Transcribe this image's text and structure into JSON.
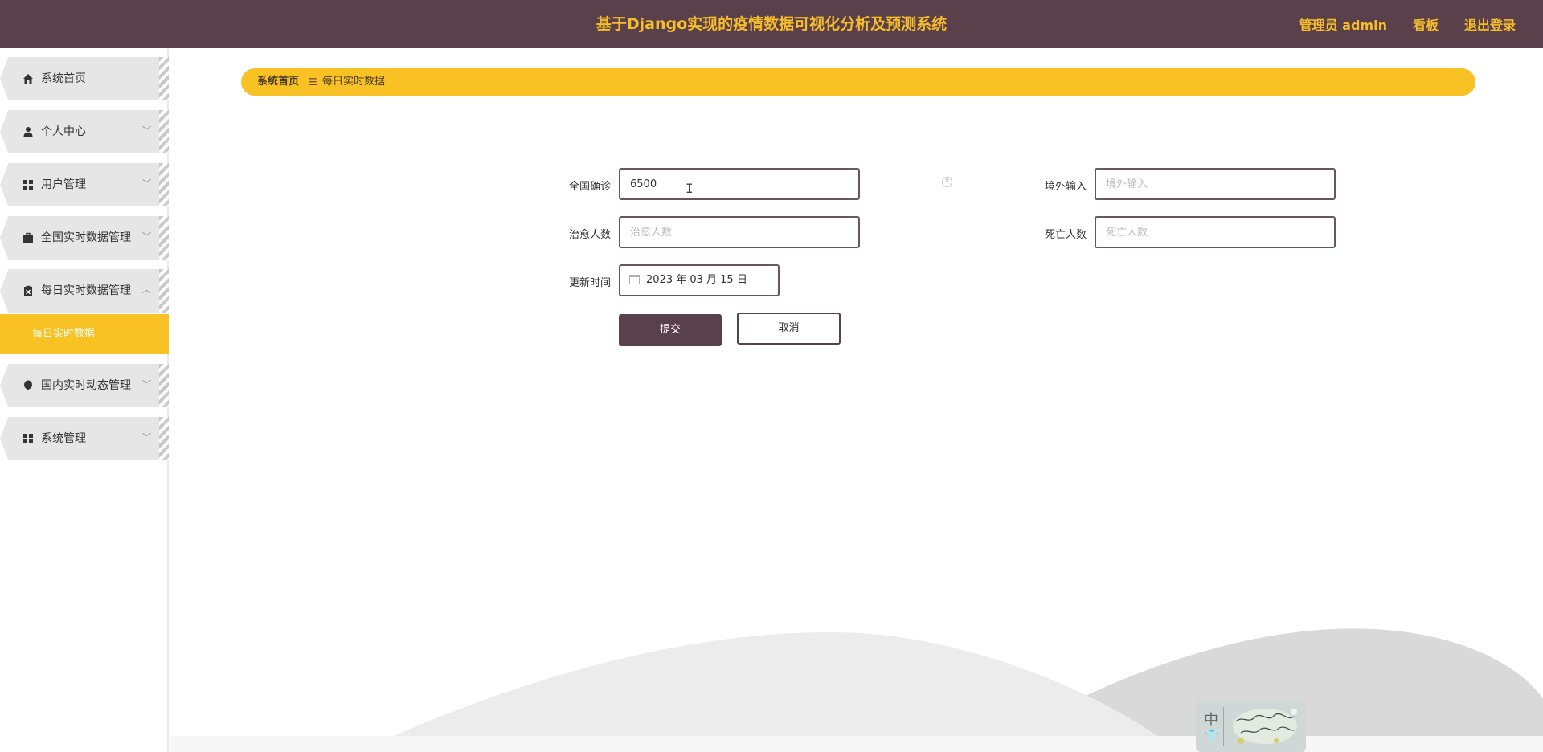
{
  "header": {
    "title": "基于Django实现的疫情数据可视化分析及预测系统",
    "admin_label": "管理员 admin",
    "board_label": "看板",
    "logout_label": "退出登录"
  },
  "sidebar": {
    "items": [
      {
        "label": "系统首页",
        "icon": "home-icon"
      },
      {
        "label": "个人中心",
        "icon": "user-icon"
      },
      {
        "label": "用户管理",
        "icon": "grid-icon"
      },
      {
        "label": "全国实时数据管理",
        "icon": "briefcase-icon"
      },
      {
        "label": "每日实时数据管理",
        "icon": "clipboard-icon",
        "expanded": true
      },
      {
        "label": "国内实时动态管理",
        "icon": "balloon-icon"
      },
      {
        "label": "系统管理",
        "icon": "grid-icon"
      }
    ],
    "sub_active": "每日实时数据"
  },
  "breadcrumb": {
    "home": "系统首页",
    "separator": "☰",
    "current": "每日实时数据"
  },
  "form": {
    "national_confirmed": {
      "label": "全国确诊",
      "value": "6500"
    },
    "imported": {
      "label": "境外输入",
      "placeholder": "境外输入"
    },
    "cured": {
      "label": "治愈人数",
      "placeholder": "治愈人数"
    },
    "deaths": {
      "label": "死亡人数",
      "placeholder": "死亡人数"
    },
    "update_time": {
      "label": "更新时间",
      "value": "2023 年 03 月 15 日"
    },
    "submit_label": "提交",
    "cancel_label": "取消"
  },
  "badge": {
    "text": "中"
  },
  "colors": {
    "header_bg": "#59404a",
    "accent": "#f8c124",
    "title_text": "#f7bd2a"
  }
}
